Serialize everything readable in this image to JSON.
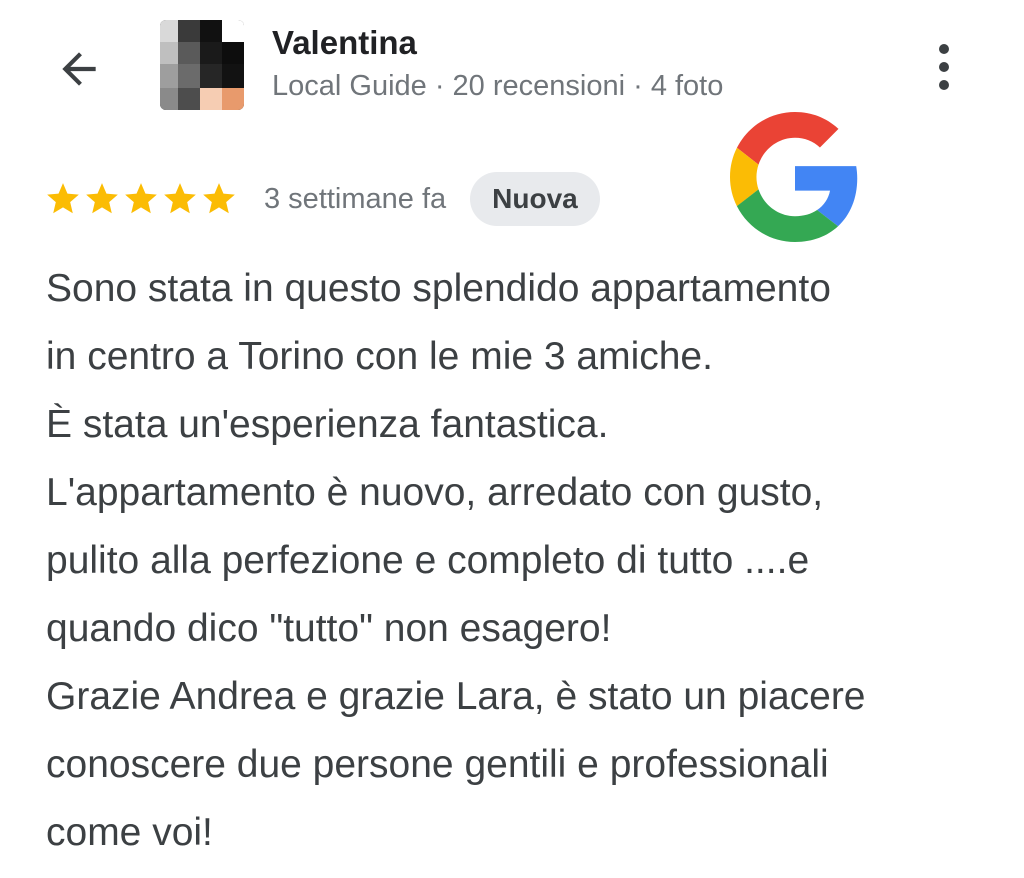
{
  "header": {
    "back_icon": "arrow-left-icon",
    "author_name": "Valentina",
    "author_meta": "Local Guide · 20 recensioni · 4 foto",
    "more_icon": "more-vertical-icon"
  },
  "review": {
    "rating": 5,
    "rating_max": 5,
    "time": "3 settimane fa",
    "badge": "Nuova",
    "lines": [
      "Sono stata in questo splendido appartamento",
      "in centro a Torino con le mie 3 amiche.",
      "È stata un'esperienza fantastica.",
      "L'appartamento è nuovo, arredato con gusto,",
      "pulito alla perfezione e completo di tutto ....e",
      "quando dico \"tutto\" non esagero!",
      "Grazie Andrea e grazie Lara, è stato un piacere",
      "conoscere due persone gentili e professionali",
      "come voi!"
    ]
  },
  "colors": {
    "star": "#fbbc04",
    "google_blue": "#4285f4",
    "google_red": "#ea4335",
    "google_yellow": "#fbbc05",
    "google_green": "#34a853",
    "badge_bg": "#e8eaed",
    "text_primary": "#3c4043",
    "text_secondary": "#70757a"
  }
}
